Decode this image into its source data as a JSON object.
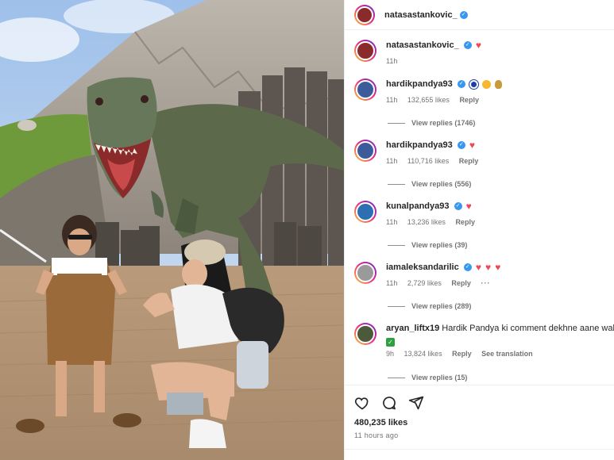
{
  "post": {
    "author": "natasastankovic_",
    "caption_time": "11h",
    "likes": "480,235 likes",
    "posted": "11 hours ago"
  },
  "comments": [
    {
      "user": "hardikpandya93",
      "time": "11h",
      "likes": "132,655 likes",
      "reply": "Reply",
      "view_replies": "View replies (1746)"
    },
    {
      "user": "hardikpandya93",
      "time": "11h",
      "likes": "110,716 likes",
      "reply": "Reply",
      "view_replies": "View replies (556)"
    },
    {
      "user": "kunalpandya93",
      "time": "11h",
      "likes": "13,236 likes",
      "reply": "Reply",
      "view_replies": "View replies (39)"
    },
    {
      "user": "iamaleksandarilic",
      "time": "11h",
      "likes": "2,729 likes",
      "reply": "Reply",
      "more": "···",
      "view_replies": "View replies (289)"
    },
    {
      "user": "aryan_liftx19",
      "text": "Hardik Pandya ki comment dekhne aane wale",
      "time": "9h",
      "likes": "13,824 likes",
      "reply": "Reply",
      "see_translation": "See translation",
      "view_replies": "View replies (15)"
    }
  ],
  "icons": [
    "heart-icon",
    "comment-icon",
    "share-icon"
  ],
  "colors": {
    "verified": "#3897f0",
    "heart": "#ed4956",
    "muted": "#737373"
  }
}
